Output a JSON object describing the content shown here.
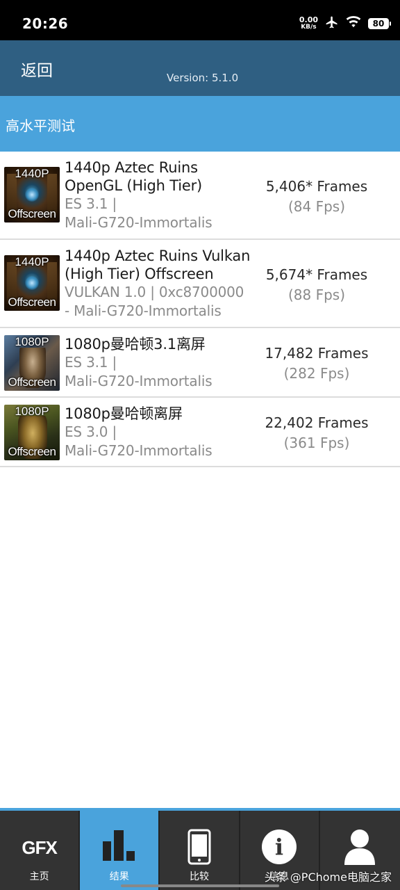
{
  "status_bar": {
    "time": "20:26",
    "net_speed_value": "0.00",
    "net_speed_unit": "KB/s",
    "battery": "80",
    "icons": [
      "airplane-icon",
      "wifi-icon",
      "battery-icon"
    ]
  },
  "header": {
    "back_label": "返回",
    "version": "Version: 5.1.0",
    "background_color": "#2f5f82"
  },
  "section": {
    "title": "高水平测试",
    "background_color": "#4aa3dc"
  },
  "results": [
    {
      "thumb_res": "1440P",
      "thumb_offscreen": "Offscreen",
      "name_line1": "1440p Aztec Ruins",
      "name_line2": "OpenGL (High Tier)",
      "api_line1": "ES 3.1 |",
      "api_line2": "Mali-G720-Immortalis",
      "frames": "5,406* Frames",
      "fps": "(84 Fps)"
    },
    {
      "thumb_res": "1440P",
      "thumb_offscreen": "Offscreen",
      "name_line1": "1440p Aztec Ruins Vulkan",
      "name_line2": "(High Tier) Offscreen",
      "api_line1": "VULKAN 1.0 | 0xc8700000",
      "api_line2": "- Mali-G720-Immortalis",
      "frames": "5,674* Frames",
      "fps": "(88 Fps)"
    },
    {
      "thumb_res": "1080P",
      "thumb_offscreen": "Offscreen",
      "name_line1": "1080p曼哈顿3.1离屏",
      "api_line1": "ES 3.1 |",
      "api_line2": "Mali-G720-Immortalis",
      "frames": "17,482 Frames",
      "fps": "(282 Fps)"
    },
    {
      "thumb_res": "1080P",
      "thumb_offscreen": "Offscreen",
      "name_line1": "1080p曼哈顿离屏",
      "api_line1": "ES 3.0 |",
      "api_line2": "Mali-G720-Immortalis",
      "frames": "22,402 Frames",
      "fps": "(361 Fps)"
    }
  ],
  "bottom_nav": {
    "tabs": [
      {
        "label": "主页",
        "logo": "GFX",
        "icon": "gfx-logo-icon",
        "active": false
      },
      {
        "label": "结果",
        "icon": "bar-chart-icon",
        "active": true
      },
      {
        "label": "比较",
        "icon": "phone-icon",
        "active": false
      },
      {
        "label": "信息",
        "icon": "info-icon",
        "active": false
      },
      {
        "label": "",
        "icon": "user-icon",
        "active": false
      }
    ],
    "active_color": "#4aa3dc"
  },
  "watermark": "头条 @PChome电脑之家"
}
